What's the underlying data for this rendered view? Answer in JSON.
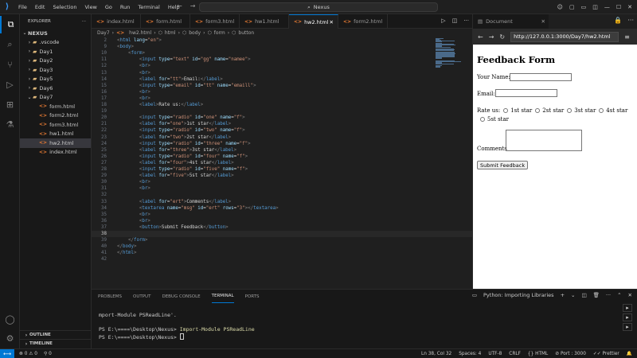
{
  "window": {
    "menu": [
      "File",
      "Edit",
      "Selection",
      "View",
      "Go",
      "Run",
      "Terminal",
      "Help"
    ],
    "search": "Nexus"
  },
  "explorer": {
    "header": "EXPLORER",
    "root": "NEXUS",
    "folders": [
      ".vscode",
      "Day1",
      "Day2",
      "Day3",
      "Day5",
      "Day6",
      "Day7"
    ],
    "files": [
      "form.html",
      "form2.html",
      "form3.html",
      "hw1.html",
      "hw2.html",
      "index.html"
    ],
    "selected": "hw2.html",
    "outline": "OUTLINE",
    "timeline": "TIMELINE"
  },
  "editor": {
    "tabs": [
      "index.html",
      "form.html",
      "form3.html",
      "hw1.html",
      "hw2.html",
      "form2.html"
    ],
    "active_tab": "hw2.html",
    "breadcrumb": [
      "Day7",
      "hw2.html",
      "html",
      "body",
      "form",
      "button"
    ],
    "current_line": 38,
    "lines": [
      {
        "n": "2",
        "html": "<span class='t-br'>&lt;</span><span class='t-tag'>html</span> <span class='t-attr'>lang</span>=<span class='t-str'>\"en\"</span><span class='t-br'>&gt;</span>"
      },
      {
        "n": "9",
        "html": "<span class='t-br'>&lt;</span><span class='t-tag'>body</span><span class='t-br'>&gt;</span>"
      },
      {
        "n": "10",
        "html": "    <span class='t-br'>&lt;</span><span class='t-tag'>form</span><span class='t-br'>&gt;</span>"
      },
      {
        "n": "11",
        "html": "        <span class='t-br'>&lt;</span><span class='t-tag'>input</span> <span class='t-attr'>type</span>=<span class='t-str'>\"text\"</span> <span class='t-attr'>id</span>=<span class='t-str'>\"gg\"</span> <span class='t-attr'>name</span>=<span class='t-str'>\"namee\"</span><span class='t-br'>&gt;</span>"
      },
      {
        "n": "12",
        "html": "        <span class='t-br'>&lt;</span><span class='t-tag'>br</span><span class='t-br'>&gt;</span>"
      },
      {
        "n": "13",
        "html": "        <span class='t-br'>&lt;</span><span class='t-tag'>br</span><span class='t-br'>&gt;</span>"
      },
      {
        "n": "14",
        "html": "        <span class='t-br'>&lt;</span><span class='t-tag'>label</span> <span class='t-attr'>for</span>=<span class='t-str'>\"tt\"</span><span class='t-br'>&gt;</span>Email:<span class='t-br'>&lt;/</span><span class='t-tag'>label</span><span class='t-br'>&gt;</span>"
      },
      {
        "n": "15",
        "html": "        <span class='t-br'>&lt;</span><span class='t-tag'>input</span> <span class='t-attr'>type</span>=<span class='t-str'>\"email\"</span> <span class='t-attr'>id</span>=<span class='t-str'>\"tt\"</span> <span class='t-attr'>name</span>=<span class='t-str'>\"emaill\"</span><span class='t-br'>&gt;</span>"
      },
      {
        "n": "16",
        "html": "        <span class='t-br'>&lt;</span><span class='t-tag'>br</span><span class='t-br'>&gt;</span>"
      },
      {
        "n": "17",
        "html": "        <span class='t-br'>&lt;</span><span class='t-tag'>br</span><span class='t-br'>&gt;</span>"
      },
      {
        "n": "18",
        "html": "        <span class='t-br'>&lt;</span><span class='t-tag'>label</span><span class='t-br'>&gt;</span>Rate us:<span class='t-br'>&lt;/</span><span class='t-tag'>label</span><span class='t-br'>&gt;</span>"
      },
      {
        "n": "19",
        "html": ""
      },
      {
        "n": "20",
        "html": "        <span class='t-br'>&lt;</span><span class='t-tag'>input</span> <span class='t-attr'>type</span>=<span class='t-str'>\"radio\"</span> <span class='t-attr'>id</span>=<span class='t-str'>\"one\"</span> <span class='t-attr'>name</span>=<span class='t-str'>\"f\"</span><span class='t-br'>&gt;</span>"
      },
      {
        "n": "21",
        "html": "        <span class='t-br'>&lt;</span><span class='t-tag'>label</span> <span class='t-attr'>for</span>=<span class='t-str'>\"one\"</span><span class='t-br'>&gt;</span>1st star<span class='t-br'>&lt;/</span><span class='t-tag'>label</span><span class='t-br'>&gt;</span>"
      },
      {
        "n": "22",
        "html": "        <span class='t-br'>&lt;</span><span class='t-tag'>input</span> <span class='t-attr'>type</span>=<span class='t-str'>\"radio\"</span> <span class='t-attr'>id</span>=<span class='t-str'>\"two\"</span> <span class='t-attr'>name</span>=<span class='t-str'>\"f\"</span><span class='t-br'>&gt;</span>"
      },
      {
        "n": "23",
        "html": "        <span class='t-br'>&lt;</span><span class='t-tag'>label</span> <span class='t-attr'>for</span>=<span class='t-str'>\"two\"</span><span class='t-br'>&gt;</span>2st star<span class='t-br'>&lt;/</span><span class='t-tag'>label</span><span class='t-br'>&gt;</span>"
      },
      {
        "n": "24",
        "html": "        <span class='t-br'>&lt;</span><span class='t-tag'>input</span> <span class='t-attr'>type</span>=<span class='t-str'>\"radio\"</span> <span class='t-attr'>id</span>=<span class='t-str'>\"three\"</span> <span class='t-attr'>name</span>=<span class='t-str'>\"f\"</span><span class='t-br'>&gt;</span>"
      },
      {
        "n": "25",
        "html": "        <span class='t-br'>&lt;</span><span class='t-tag'>label</span> <span class='t-attr'>for</span>=<span class='t-str'>\"three\"</span><span class='t-br'>&gt;</span>3st star<span class='t-br'>&lt;/</span><span class='t-tag'>label</span><span class='t-br'>&gt;</span>"
      },
      {
        "n": "26",
        "html": "        <span class='t-br'>&lt;</span><span class='t-tag'>input</span> <span class='t-attr'>type</span>=<span class='t-str'>\"radio\"</span> <span class='t-attr'>id</span>=<span class='t-str'>\"four\"</span> <span class='t-attr'>name</span>=<span class='t-str'>\"f\"</span><span class='t-br'>&gt;</span>"
      },
      {
        "n": "27",
        "html": "        <span class='t-br'>&lt;</span><span class='t-tag'>label</span> <span class='t-attr'>for</span>=<span class='t-str'>\"four\"</span><span class='t-br'>&gt;</span>4st star<span class='t-br'>&lt;/</span><span class='t-tag'>label</span><span class='t-br'>&gt;</span>"
      },
      {
        "n": "28",
        "html": "        <span class='t-br'>&lt;</span><span class='t-tag'>input</span> <span class='t-attr'>type</span>=<span class='t-str'>\"radio\"</span> <span class='t-attr'>id</span>=<span class='t-str'>\"five\"</span> <span class='t-attr'>name</span>=<span class='t-str'>\"f\"</span><span class='t-br'>&gt;</span>"
      },
      {
        "n": "29",
        "html": "        <span class='t-br'>&lt;</span><span class='t-tag'>label</span> <span class='t-attr'>for</span>=<span class='t-str'>\"five\"</span><span class='t-br'>&gt;</span>5st star<span class='t-br'>&lt;/</span><span class='t-tag'>label</span><span class='t-br'>&gt;</span>"
      },
      {
        "n": "30",
        "html": "        <span class='t-br'>&lt;</span><span class='t-tag'>br</span><span class='t-br'>&gt;</span>"
      },
      {
        "n": "31",
        "html": "        <span class='t-br'>&lt;</span><span class='t-tag'>br</span><span class='t-br'>&gt;</span>"
      },
      {
        "n": "32",
        "html": ""
      },
      {
        "n": "33",
        "html": "        <span class='t-br'>&lt;</span><span class='t-tag'>label</span> <span class='t-attr'>for</span>=<span class='t-str'>\"ert\"</span><span class='t-br'>&gt;</span>Comments<span class='t-br'>&lt;/</span><span class='t-tag'>label</span><span class='t-br'>&gt;</span>"
      },
      {
        "n": "34",
        "html": "        <span class='t-br'>&lt;</span><span class='t-tag'>textarea</span> <span class='t-attr'>name</span>=<span class='t-str'>\"msg\"</span> <span class='t-attr'>id</span>=<span class='t-str'>\"ert\"</span> <span class='t-attr'>rows</span>=<span class='t-str'>\"3\"</span><span class='t-br'>&gt;&lt;/</span><span class='t-tag'>textarea</span><span class='t-br'>&gt;</span>"
      },
      {
        "n": "35",
        "html": "        <span class='t-br'>&lt;</span><span class='t-tag'>br</span><span class='t-br'>&gt;</span>"
      },
      {
        "n": "36",
        "html": "        <span class='t-br'>&lt;</span><span class='t-tag'>br</span><span class='t-br'>&gt;</span>"
      },
      {
        "n": "37",
        "html": "        <span class='t-br'>&lt;</span><span class='t-tag'>button</span><span class='t-br'>&gt;</span>Submit Feedback<span class='t-br'>&lt;/</span><span class='t-tag'>button</span><span class='t-br'>&gt;</span>"
      },
      {
        "n": "38",
        "html": ""
      },
      {
        "n": "39",
        "html": "    <span class='t-br'>&lt;/</span><span class='t-tag'>form</span><span class='t-br'>&gt;</span>"
      },
      {
        "n": "40",
        "html": "<span class='t-br'>&lt;/</span><span class='t-tag'>body</span><span class='t-br'>&gt;</span>"
      },
      {
        "n": "41",
        "html": "<span class='t-br'>&lt;/</span><span class='t-tag'>html</span><span class='t-br'>&gt;</span>"
      },
      {
        "n": "42",
        "html": ""
      }
    ]
  },
  "preview": {
    "tab_title": "Document",
    "url": "http://127.0.0.1:3000/Day7/hw2.html",
    "heading": "Feedback Form",
    "name_label": "Your Name:",
    "email_label": "Email:",
    "rate_label": "Rate us:",
    "stars": [
      "1st star",
      "2st star",
      "3st star",
      "4st star",
      "5st star"
    ],
    "comments_label": "Comments",
    "button": "Submit Feedback"
  },
  "panel": {
    "tabs": [
      "PROBLEMS",
      "OUTPUT",
      "DEBUG CONSOLE",
      "TERMINAL",
      "PORTS"
    ],
    "active_tab": "TERMINAL",
    "terminal_label": "Python: Importing Libraries",
    "lines": [
      "mport-Module PSReadLine'.",
      "",
      "PS E:\\====\\Desktop\\Nexus> ",
      "PS E:\\====\\Desktop\\Nexus> "
    ],
    "command": "Import-Module PSReadLine"
  },
  "status": {
    "errors": "0",
    "warnings": "0",
    "ports": "0",
    "position": "Ln 38, Col 32",
    "spaces": "Spaces: 4",
    "encoding": "UTF-8",
    "eol": "CRLF",
    "language": "HTML",
    "port": "Port : 3000",
    "prettier": "Prettier"
  },
  "colors": {
    "accent": "#0078d4",
    "folder": "#dcb67a",
    "html_icon": "#e37933"
  }
}
